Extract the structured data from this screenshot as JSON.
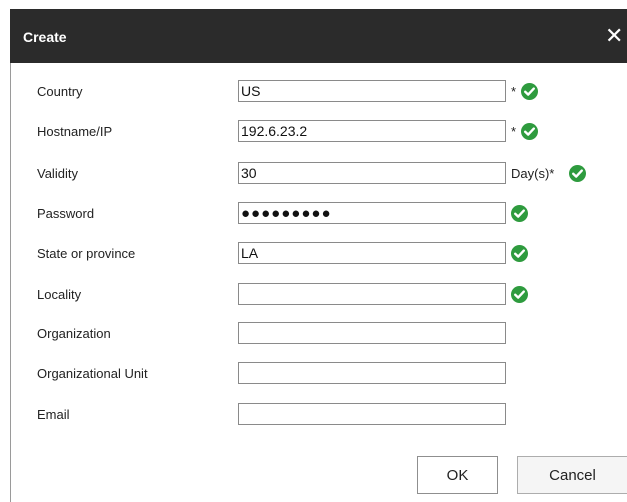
{
  "dialog": {
    "title": "Create",
    "close_glyph": "✕"
  },
  "form": {
    "fields": [
      {
        "label": "Country",
        "value": "US",
        "suffix": "*",
        "valid": true
      },
      {
        "label": "Hostname/IP",
        "value": "192.6.23.2",
        "suffix": "*",
        "valid": true
      },
      {
        "label": "Validity",
        "value": "30",
        "suffix": "Day(s)*",
        "valid": true
      },
      {
        "label": "Password",
        "value": "●●●●●●●●●",
        "suffix": "",
        "valid": true
      },
      {
        "label": "State or province",
        "value": "LA",
        "suffix": "",
        "valid": true
      },
      {
        "label": "Locality",
        "value": "",
        "suffix": "",
        "valid": true
      },
      {
        "label": "Organization",
        "value": "",
        "suffix": "",
        "valid": false
      },
      {
        "label": "Organizational Unit",
        "value": "",
        "suffix": "",
        "valid": false
      },
      {
        "label": "Email",
        "value": "",
        "suffix": "",
        "valid": false
      }
    ]
  },
  "buttons": {
    "ok_label": "OK",
    "cancel_label": "Cancel"
  },
  "colors": {
    "titlebar": "#2b2b2b",
    "check": "#2e9b3e"
  },
  "icons": {
    "close": "close-icon",
    "valid": "check-circle-icon"
  }
}
